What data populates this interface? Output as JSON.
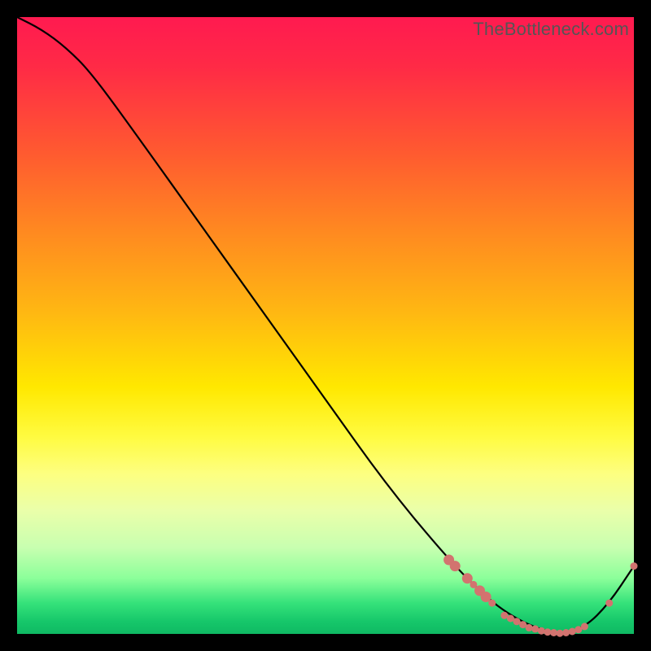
{
  "watermark": "TheBottleneck.com",
  "chart_data": {
    "type": "line",
    "title": "",
    "xlabel": "",
    "ylabel": "",
    "xlim": [
      0,
      100
    ],
    "ylim": [
      0,
      100
    ],
    "series": [
      {
        "name": "curve",
        "x": [
          0,
          4,
          8,
          12,
          20,
          30,
          40,
          50,
          60,
          70,
          76,
          80,
          84,
          88,
          92,
          96,
          100
        ],
        "y": [
          100,
          98,
          95,
          91,
          80,
          66,
          52,
          38,
          24,
          12,
          6,
          3,
          1,
          0,
          1,
          5,
          11
        ]
      }
    ],
    "markers": [
      {
        "x": 70,
        "y": 12,
        "size": "large"
      },
      {
        "x": 71,
        "y": 11,
        "size": "large"
      },
      {
        "x": 73,
        "y": 9,
        "size": "large"
      },
      {
        "x": 74,
        "y": 8,
        "size": "small"
      },
      {
        "x": 75,
        "y": 7,
        "size": "large"
      },
      {
        "x": 76,
        "y": 6,
        "size": "large"
      },
      {
        "x": 77,
        "y": 5,
        "size": "small"
      },
      {
        "x": 79,
        "y": 3,
        "size": "small"
      },
      {
        "x": 80,
        "y": 2.5,
        "size": "small"
      },
      {
        "x": 81,
        "y": 2,
        "size": "small"
      },
      {
        "x": 82,
        "y": 1.5,
        "size": "small"
      },
      {
        "x": 83,
        "y": 1,
        "size": "small"
      },
      {
        "x": 84,
        "y": 0.8,
        "size": "small"
      },
      {
        "x": 85,
        "y": 0.5,
        "size": "small"
      },
      {
        "x": 86,
        "y": 0.3,
        "size": "small"
      },
      {
        "x": 87,
        "y": 0.2,
        "size": "small"
      },
      {
        "x": 88,
        "y": 0.1,
        "size": "small"
      },
      {
        "x": 89,
        "y": 0.2,
        "size": "small"
      },
      {
        "x": 90,
        "y": 0.4,
        "size": "small"
      },
      {
        "x": 91,
        "y": 0.7,
        "size": "small"
      },
      {
        "x": 92,
        "y": 1.2,
        "size": "small"
      },
      {
        "x": 96,
        "y": 5,
        "size": "small"
      },
      {
        "x": 100,
        "y": 11,
        "size": "small"
      }
    ]
  }
}
